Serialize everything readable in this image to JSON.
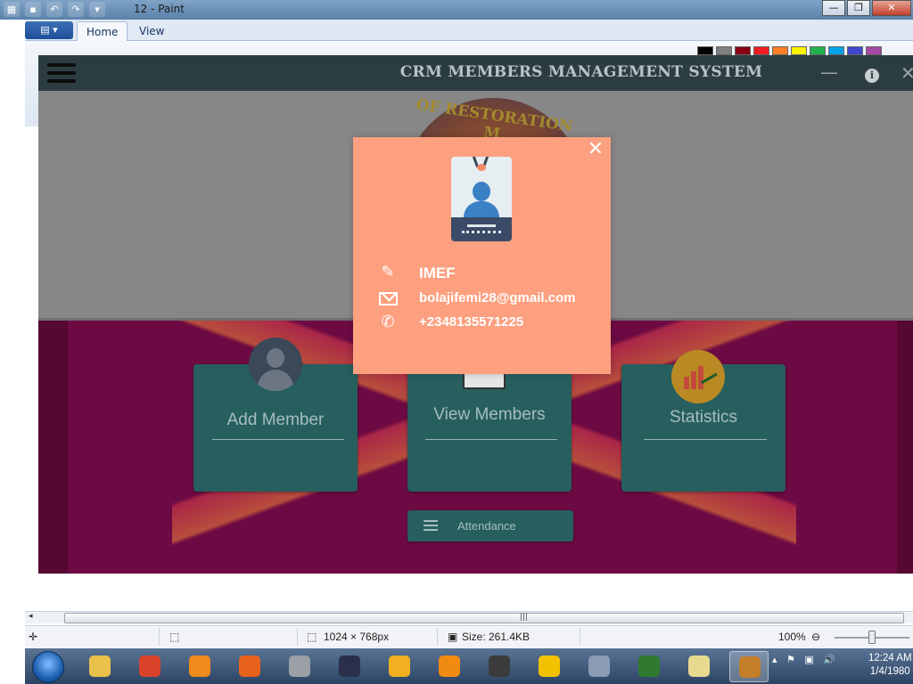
{
  "paint": {
    "window_title": "12 - Paint",
    "tabs": [
      "Home",
      "View"
    ],
    "menu_glyph": "▤ ▾",
    "window_controls": {
      "minimize": "—",
      "restore": "❐",
      "close": "✕"
    },
    "status": {
      "dimensions": "1024 × 768px",
      "size": "Size: 261.4KB",
      "zoom": "100%"
    },
    "scroll_grip": "|||",
    "scroll_left": "◂",
    "palette": [
      "#000000",
      "#7f7f7f",
      "#880015",
      "#ed1c24",
      "#ff7f27",
      "#fff200",
      "#22b14c",
      "#00a2e8",
      "#3f48cc",
      "#a349a4"
    ]
  },
  "crm": {
    "title": "CRM MEMBERS MANAGEMENT SYSTEM",
    "logo_text": "OF RESTORATION M",
    "cards": [
      {
        "label": "Add Member"
      },
      {
        "label": "View Members"
      },
      {
        "label": "Statistics"
      }
    ],
    "attendance_label": "Attendance",
    "header_controls": {
      "minimize": "—",
      "info": "i",
      "close": "✕"
    }
  },
  "modal": {
    "close_glyph": "✕",
    "name": "IMEF",
    "email": "bolajifemi28@gmail.com",
    "phone": "+2348135571225",
    "icons": {
      "name": "pencil-icon",
      "email": "envelope-icon",
      "phone": "phone-icon"
    },
    "background": "#fda080"
  },
  "taskbar": {
    "clock_time": "12:24 AM",
    "clock_date": "1/4/1980",
    "tray_glyphs": [
      "▴",
      "⚑",
      "▣",
      "🔊"
    ],
    "icon_colors": [
      "#e9c04a",
      "#d8432a",
      "#f08a1a",
      "#e8621c",
      "#9aa0a6",
      "#2a2f4a",
      "#f0b020",
      "#f08a10",
      "#3b3b3b",
      "#f2c200",
      "#8a9bb6",
      "#2f7a2f",
      "#e7d98f",
      "#c47f2a"
    ]
  }
}
